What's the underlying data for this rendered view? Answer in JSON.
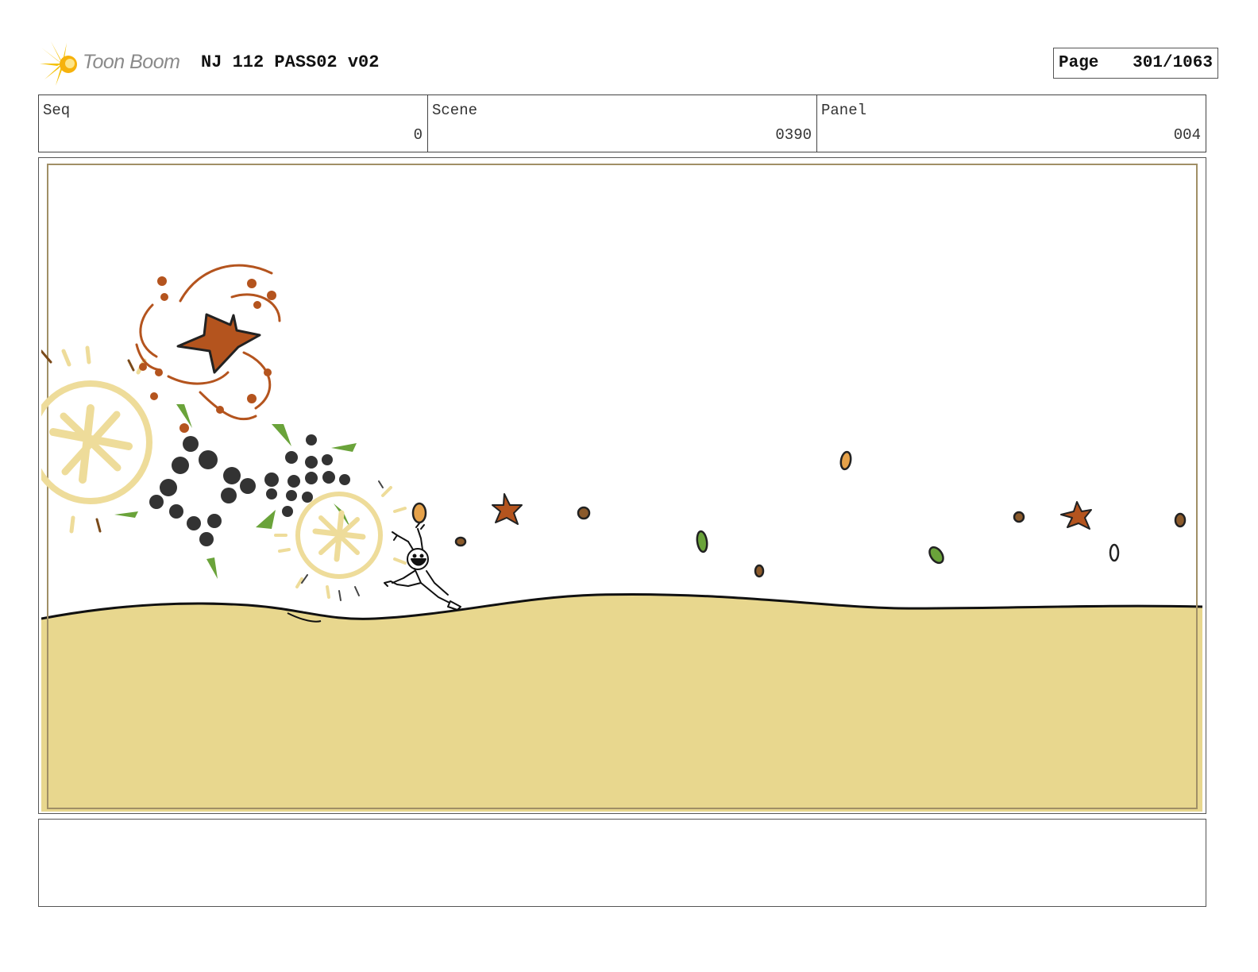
{
  "header": {
    "logo_text": "Toon Boom",
    "project_title": "NJ 112 PASS02 v02",
    "page_label": "Page",
    "page_value": "301/1063"
  },
  "info": {
    "seq_label": "Seq",
    "seq_value": "0",
    "scene_label": "Scene",
    "scene_value": "0390",
    "panel_label": "Panel",
    "panel_value": "004"
  },
  "colors": {
    "sand": "#e8d78e",
    "seed_brown": "#b4541e",
    "leaf_green": "#6aa33a",
    "burst_yellow": "#eedc9a",
    "dark_dot": "#333333"
  },
  "notes": {
    "text": ""
  }
}
